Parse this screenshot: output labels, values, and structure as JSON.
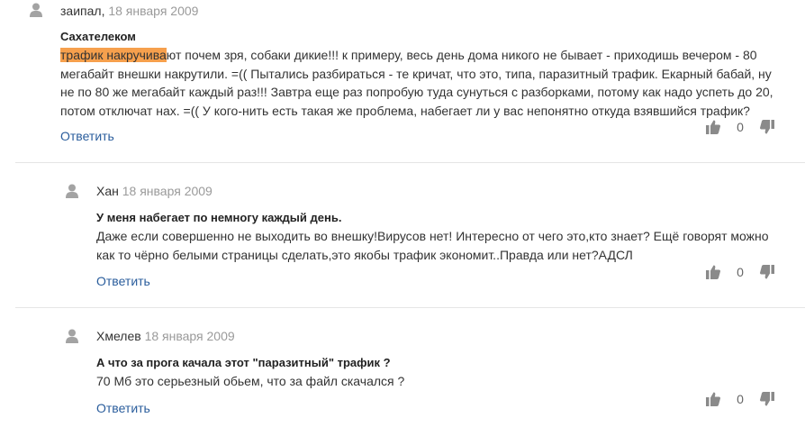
{
  "comments": [
    {
      "author": "заипал",
      "separator": ",",
      "date": "18 января 2009",
      "title": "Сахателеком",
      "highlight": "трафик накручива",
      "lines": [
        "ют почем зря, собаки дикие!!! к примеру, весь день дома никого не бывает - приходишь вечером - 80",
        "мегабайт внешки накрутили. =(( Пытались разбираться - те кричат, что это, типа, паразитный трафик. Екарный бабай, ну",
        "не по 80 же мегабайт каждый раз!!! Завтра еще раз попробую туда сунуться с разборками, потому как надо успеть до 20,",
        "потом отключат нах. =(( У кого-нить есть такая же проблема, набегает ли у вас непонятно откуда взявшийся трафик?"
      ],
      "reply_label": "Ответить",
      "votes": "0"
    },
    {
      "author": "Хан",
      "separator": "",
      "date": "18 января 2009",
      "title": "У меня набегает по немногу каждый день.",
      "lines": [
        "Даже если совершенно не выходить во внешку!Вирусов нет! Интересно от чего это,кто знает? Ещё говорят можно",
        "как то чёрно белыми страницы сделать,это якобы трафик экономит..Правда или нет?АДСЛ"
      ],
      "reply_label": "Ответить",
      "votes": "0"
    },
    {
      "author": "Хмелев",
      "separator": "",
      "date": "18 января 2009",
      "title": "А что за прога качала этот \"паразитный\" трафик ?",
      "lines": [
        "70 Мб это серьезный обьем, что за файл скачался ?"
      ],
      "reply_label": "Ответить",
      "votes": "0"
    }
  ],
  "icons": {
    "avatar": "user-silhouette",
    "vote_up": "thumbs-up",
    "vote_down": "thumbs-down",
    "icon_color": "#888888",
    "highlight_color": "#f6a04d",
    "link_color": "#2a5d9c",
    "date_color": "#9a9a9a"
  }
}
